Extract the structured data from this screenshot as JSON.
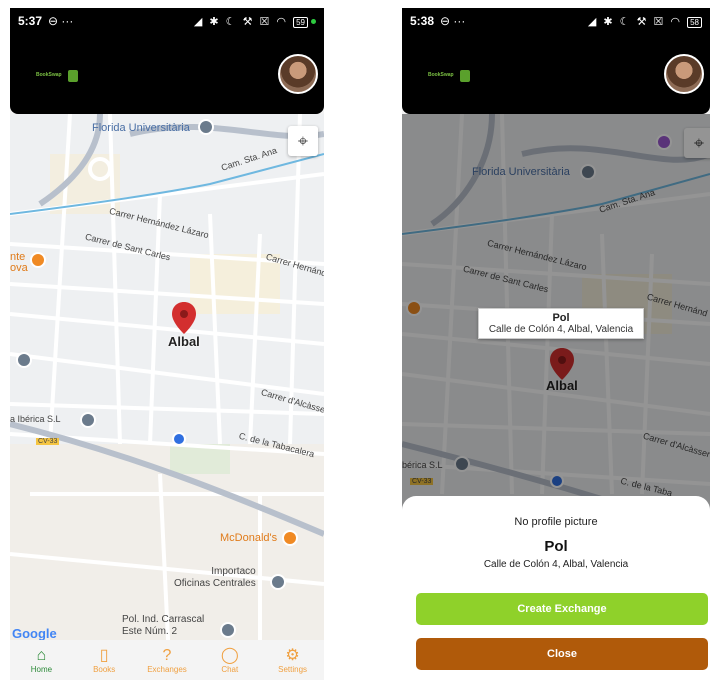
{
  "left": {
    "status": {
      "time": "5:37",
      "battery": "59"
    },
    "logo_text": "BookSwap",
    "map_labels": {
      "florida": "Florida Universitària",
      "cam_sta_ana": "Cam. Sta. Ana",
      "hernandez_lazaro": "Carrer Hernández Lázaro",
      "sant_carles": "Carrer de Sant Carles",
      "hernandez_right": "Carrer Hernánd",
      "pin_label": "Albal",
      "alcasser": "Carrer d'Alcàsse",
      "tabacalera": "C. de la Tabacalera",
      "iberica": "a Ibérica S.L",
      "cv33": "CV-33",
      "mcdonalds": "McDonald's",
      "importaco": "Importaco\nOficinas Centrales",
      "pol_ind": "Pol. Ind. Carrascal\nEste Núm. 2",
      "nte_ova": "nte\nova",
      "google": "Google"
    },
    "nav": [
      {
        "label": "Home",
        "icon": "home-icon",
        "glyph": "⌂"
      },
      {
        "label": "Books",
        "icon": "book-icon",
        "glyph": "▯"
      },
      {
        "label": "Exchanges",
        "icon": "question-icon",
        "glyph": "?"
      },
      {
        "label": "Chat",
        "icon": "chat-icon",
        "glyph": "◯"
      },
      {
        "label": "Settings",
        "icon": "gear-icon",
        "glyph": "⚙"
      }
    ]
  },
  "right": {
    "status": {
      "time": "5:38",
      "battery": "58"
    },
    "logo_text": "BookSwap",
    "map_labels": {
      "florida": "Florida Universitària",
      "cam_sta_ana": "Cam. Sta. Ana",
      "hernandez_lazaro": "Carrer Hernández Lázaro",
      "sant_carles": "Carrer de Sant Carles",
      "hernandez_right": "Carrer Hernánd",
      "pin_label": "Albal",
      "alcasser": "Carrer d'Alcàsser",
      "iberica": "bérica S.L",
      "cv33": "CV-33",
      "tabacalera": "C. de la Taba"
    },
    "infowindow": {
      "title": "Pol",
      "address": "Calle de Colón 4, Albal, Valencia"
    },
    "sheet": {
      "no_picture": "No profile picture",
      "name": "Pol",
      "address": "Calle de Colón 4, Albal, Valencia",
      "create_label": "Create Exchange",
      "close_label": "Close"
    }
  },
  "colors": {
    "create": "#8fd12a",
    "close": "#b05a0a",
    "pin": "#d32f2f",
    "nav_active": "#2e8b3a",
    "nav_inactive": "#f0a040"
  }
}
